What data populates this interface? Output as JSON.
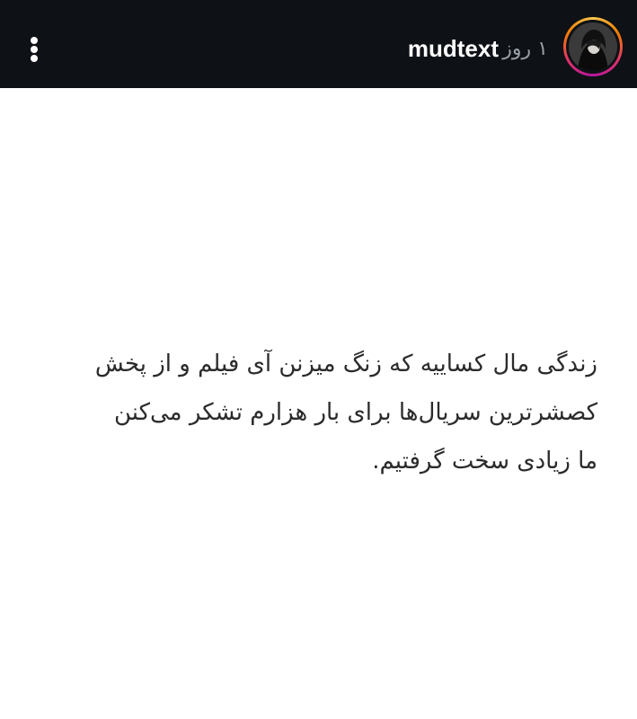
{
  "header": {
    "username": "mudtext",
    "time_ago": "۱ روز",
    "menu_icon": "more-vertical-icon",
    "avatar_icon": "profile-avatar"
  },
  "post": {
    "lines": [
      "زندگی مال کساییه که زنگ میزنن آی فیلم و از پخش",
      "کصشرترین سریال‌ها برای بار هزارم تشکر می‌کنن",
      "ما زیادی سخت گرفتیم."
    ]
  }
}
